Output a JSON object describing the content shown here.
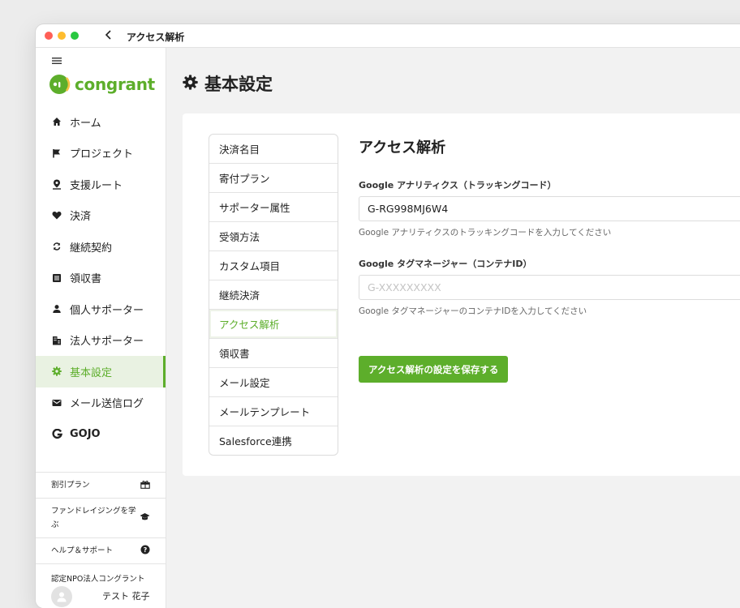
{
  "window": {
    "title": "アクセス解析"
  },
  "brand": {
    "name": "congrant",
    "accent": "#5dae2b"
  },
  "sidebar": {
    "items": [
      {
        "label": "ホーム",
        "icon": "home-icon"
      },
      {
        "label": "プロジェクト",
        "icon": "flag-icon"
      },
      {
        "label": "支援ルート",
        "icon": "map-pin-icon"
      },
      {
        "label": "決済",
        "icon": "heart-icon"
      },
      {
        "label": "継続契約",
        "icon": "refresh-icon"
      },
      {
        "label": "領収書",
        "icon": "receipt-icon"
      },
      {
        "label": "個人サポーター",
        "icon": "person-icon"
      },
      {
        "label": "法人サポーター",
        "icon": "building-icon"
      },
      {
        "label": "基本設定",
        "icon": "gear-icon",
        "active": true
      },
      {
        "label": "メール送信ログ",
        "icon": "mail-icon"
      },
      {
        "label": "GOJO",
        "icon": "gojo-logo-icon"
      }
    ],
    "sub_items": [
      {
        "label": "割引プラン",
        "icon": "gift-icon"
      },
      {
        "label": "ファンドレイジングを学ぶ",
        "icon": "graduation-cap-icon"
      },
      {
        "label": "ヘルプ＆サポート",
        "icon": "help-icon"
      }
    ],
    "org_name": "認定NPO法人コングラント",
    "user_name": "テスト 花子"
  },
  "page": {
    "title": "基本設定"
  },
  "settings_menu": [
    {
      "label": "決済名目"
    },
    {
      "label": "寄付プラン"
    },
    {
      "label": "サポーター属性"
    },
    {
      "label": "受領方法"
    },
    {
      "label": "カスタム項目"
    },
    {
      "label": "継続決済"
    },
    {
      "label": "アクセス解析",
      "active": true
    },
    {
      "label": "領収書"
    },
    {
      "label": "メール設定"
    },
    {
      "label": "メールテンプレート"
    },
    {
      "label": "Salesforce連携"
    }
  ],
  "section": {
    "title": "アクセス解析",
    "ga": {
      "label": "Google アナリティクス（トラッキングコード）",
      "value": "G-RG998MJ6W4",
      "hint": "Google アナリティクスのトラッキングコードを入力してください"
    },
    "gtm": {
      "label": "Google タグマネージャー（コンテナID）",
      "value": "",
      "placeholder": "G-XXXXXXXXX",
      "hint": "Google タグマネージャーのコンテナIDを入力してください"
    },
    "save_label": "アクセス解析の設定を保存する"
  }
}
